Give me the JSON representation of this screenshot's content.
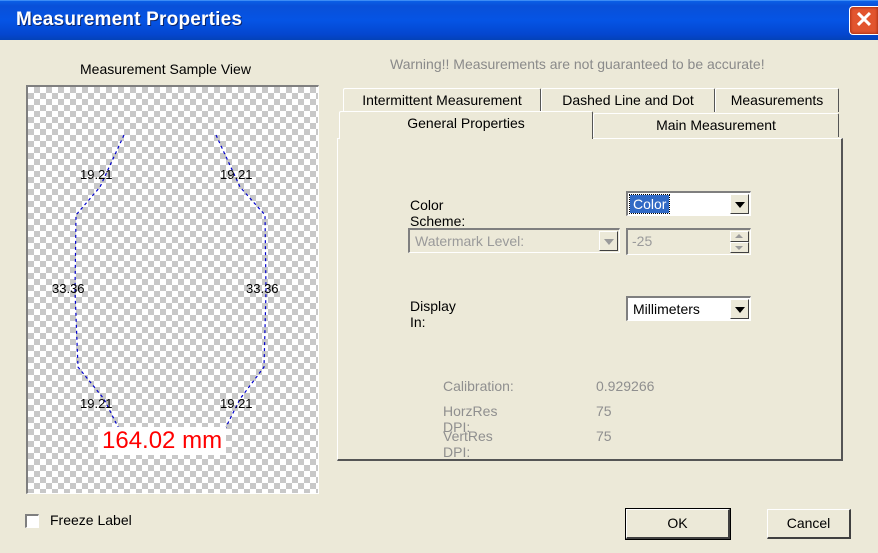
{
  "window": {
    "title": "Measurement Properties",
    "close_glyph": "✕"
  },
  "sample": {
    "caption": "Measurement Sample View",
    "segments": [
      "19.21",
      "19.21",
      "33.36",
      "33.36",
      "19.21",
      "19.21"
    ],
    "total": "164.02 mm",
    "total_color": "#ff0000",
    "line_color": "#0000cc"
  },
  "warning": "Warning!!  Measurements are not guaranteed to be accurate!",
  "tabs": {
    "back": [
      "Intermittent Measurement",
      "Dashed Line and Dot",
      "Measurements"
    ],
    "front": [
      "General Properties",
      "Main Measurement"
    ],
    "active": "General Properties"
  },
  "general": {
    "color_scheme": {
      "label": "Color Scheme:",
      "value": "Color"
    },
    "watermark": {
      "label": "Watermark Level:",
      "value": "-25"
    },
    "display_in": {
      "label": "Display In:",
      "value": "Millimeters"
    },
    "calibration": {
      "label": "Calibration:",
      "value": "0.929266"
    },
    "horz_res": {
      "label": "HorzRes DPI:",
      "value": "75"
    },
    "vert_res": {
      "label": "VertRes DPI:",
      "value": "75"
    }
  },
  "footer": {
    "freeze_label": "Freeze Label",
    "freeze_checked": false,
    "ok": "OK",
    "cancel": "Cancel"
  }
}
